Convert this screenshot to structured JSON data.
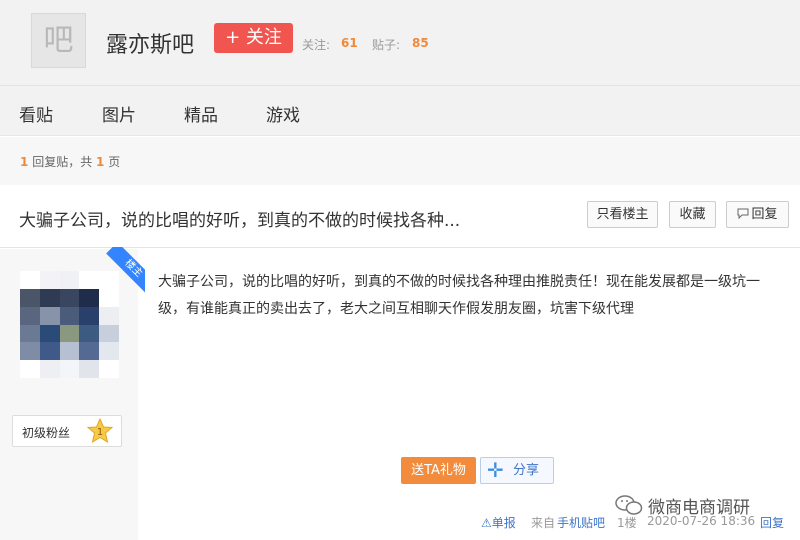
{
  "forum": {
    "logo_char": "吧",
    "name": "露亦斯吧",
    "follow_label": "+ 关注",
    "stats": [
      {
        "label": "关注:",
        "value": "61"
      },
      {
        "label": "贴子:",
        "value": "85"
      }
    ]
  },
  "tabs": [
    "看贴",
    "图片",
    "精品",
    "游戏"
  ],
  "pager": {
    "reply_count": "1",
    "reply_text": "回复贴，共",
    "page_count": "1",
    "page_unit": "页"
  },
  "thread": {
    "title": "大骗子公司，说的比唱的好听，到真的不做的时候找各种...",
    "buttons": [
      "只看楼主",
      "收藏",
      "回复"
    ]
  },
  "post": {
    "author_badge": "楼主",
    "level_name": "初级粉丝",
    "level_number": "1",
    "content": "大骗子公司，说的比唱的好听，到真的不做的时候找各种理由推脱责任！现在能发展都是一级坑一级，有谁能真正的卖出去了，老大之间互相聊天作假发朋友圈，坑害下级代理",
    "gift_label": "送TA礼物",
    "share_label": "分享",
    "footer": {
      "report": "⚠单报",
      "from_label": "来自",
      "source": "手机贴吧",
      "floor": "1楼",
      "timestamp": "2020-07-26 18:36",
      "reply": "回复"
    }
  },
  "watermark": "微商电商调研",
  "colors": {
    "accent_orange": "#f08a3a",
    "follow_red": "#f0564f",
    "link_blue": "#3d74c8"
  }
}
